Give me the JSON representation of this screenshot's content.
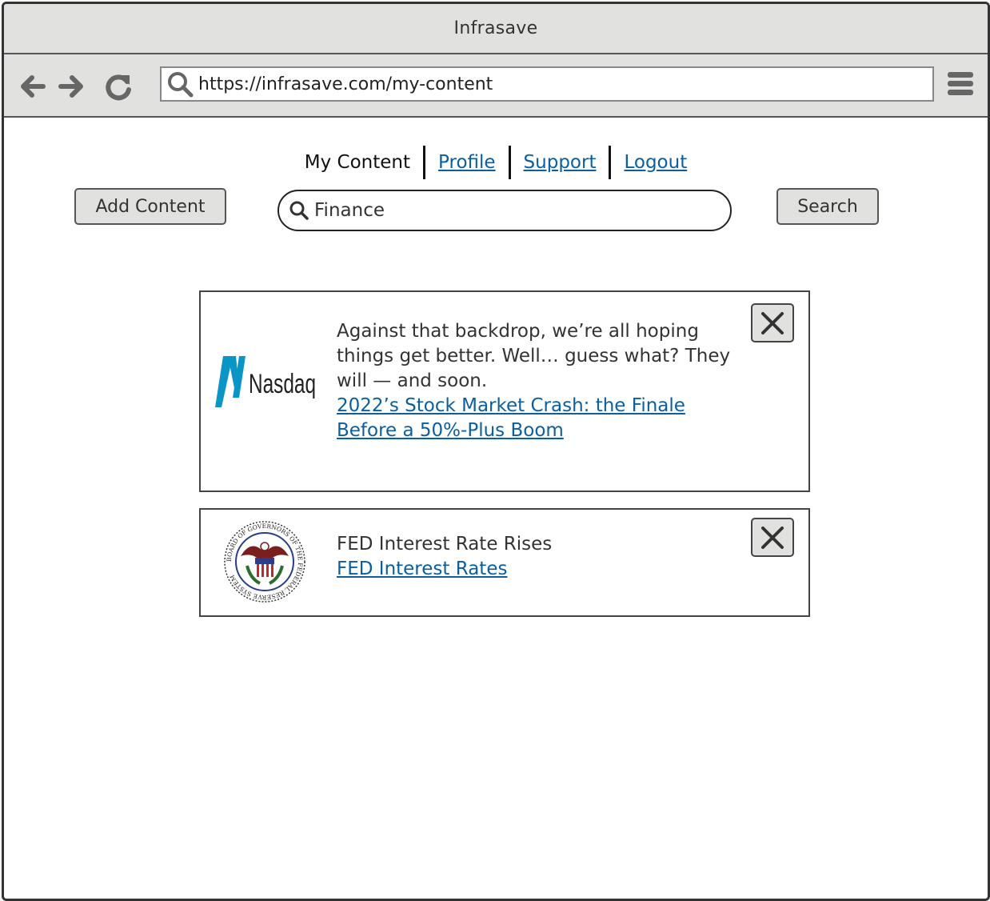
{
  "window": {
    "title": "Infrasave"
  },
  "browser": {
    "url": "https://infrasave.com/my-content",
    "back_icon": "arrow-left-icon",
    "forward_icon": "arrow-right-icon",
    "reload_icon": "reload-icon",
    "menu_icon": "hamburger-menu-icon"
  },
  "nav": {
    "tabs": [
      {
        "label": "My Content",
        "current": true
      },
      {
        "label": "Profile",
        "current": false
      },
      {
        "label": "Support",
        "current": false
      },
      {
        "label": "Logout",
        "current": false
      }
    ]
  },
  "toolbar": {
    "add_label": "Add Content",
    "search_value": "Finance",
    "search_button_label": "Search"
  },
  "cards": [
    {
      "logo_text": "Nasdaq",
      "description": "Against that backdrop, we’re all hoping things get better. Well… guess what? They will — and soon.",
      "link_label": "2022’s Stock Market Crash: the Finale Before a 50%-Plus Boom"
    },
    {
      "logo_text": "BOARD OF GOVERNORS OF THE FEDERAL RESERVE SYSTEM",
      "description": "FED Interest Rate Rises",
      "link_label": "FED Interest Rates"
    }
  ],
  "colors": {
    "chrome": "#e1e1e0",
    "link": "#0b5ea0",
    "nasdaq_blue": "#0996c7"
  }
}
